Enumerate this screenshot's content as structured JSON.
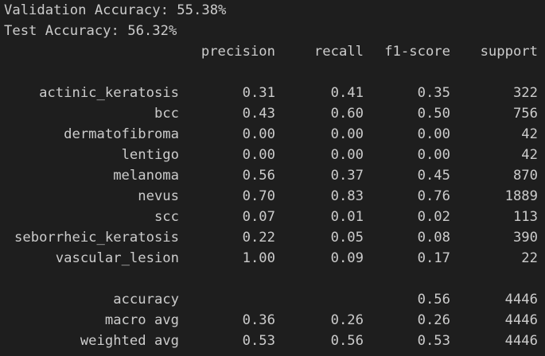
{
  "validation_accuracy": "Validation Accuracy: 55.38%",
  "test_accuracy": "Test Accuracy: 56.32%",
  "report": {
    "headers": {
      "precision": "precision",
      "recall": "recall",
      "f1_score": "f1-score",
      "support": "support"
    },
    "classes": [
      {
        "label": "actinic_keratosis",
        "precision": "0.31",
        "recall": "0.41",
        "f1": "0.35",
        "support": "322"
      },
      {
        "label": "bcc",
        "precision": "0.43",
        "recall": "0.60",
        "f1": "0.50",
        "support": "756"
      },
      {
        "label": "dermatofibroma",
        "precision": "0.00",
        "recall": "0.00",
        "f1": "0.00",
        "support": "42"
      },
      {
        "label": "lentigo",
        "precision": "0.00",
        "recall": "0.00",
        "f1": "0.00",
        "support": "42"
      },
      {
        "label": "melanoma",
        "precision": "0.56",
        "recall": "0.37",
        "f1": "0.45",
        "support": "870"
      },
      {
        "label": "nevus",
        "precision": "0.70",
        "recall": "0.83",
        "f1": "0.76",
        "support": "1889"
      },
      {
        "label": "scc",
        "precision": "0.07",
        "recall": "0.01",
        "f1": "0.02",
        "support": "113"
      },
      {
        "label": "seborrheic_keratosis",
        "precision": "0.22",
        "recall": "0.05",
        "f1": "0.08",
        "support": "390"
      },
      {
        "label": "vascular_lesion",
        "precision": "1.00",
        "recall": "0.09",
        "f1": "0.17",
        "support": "22"
      }
    ],
    "summary": [
      {
        "label": "accuracy",
        "precision": "",
        "recall": "",
        "f1": "0.56",
        "support": "4446"
      },
      {
        "label": "macro avg",
        "precision": "0.36",
        "recall": "0.26",
        "f1": "0.26",
        "support": "4446"
      },
      {
        "label": "weighted avg",
        "precision": "0.53",
        "recall": "0.56",
        "f1": "0.53",
        "support": "4446"
      }
    ]
  },
  "colors": {
    "background": "#1e1e1e",
    "text": "#cccccc"
  }
}
